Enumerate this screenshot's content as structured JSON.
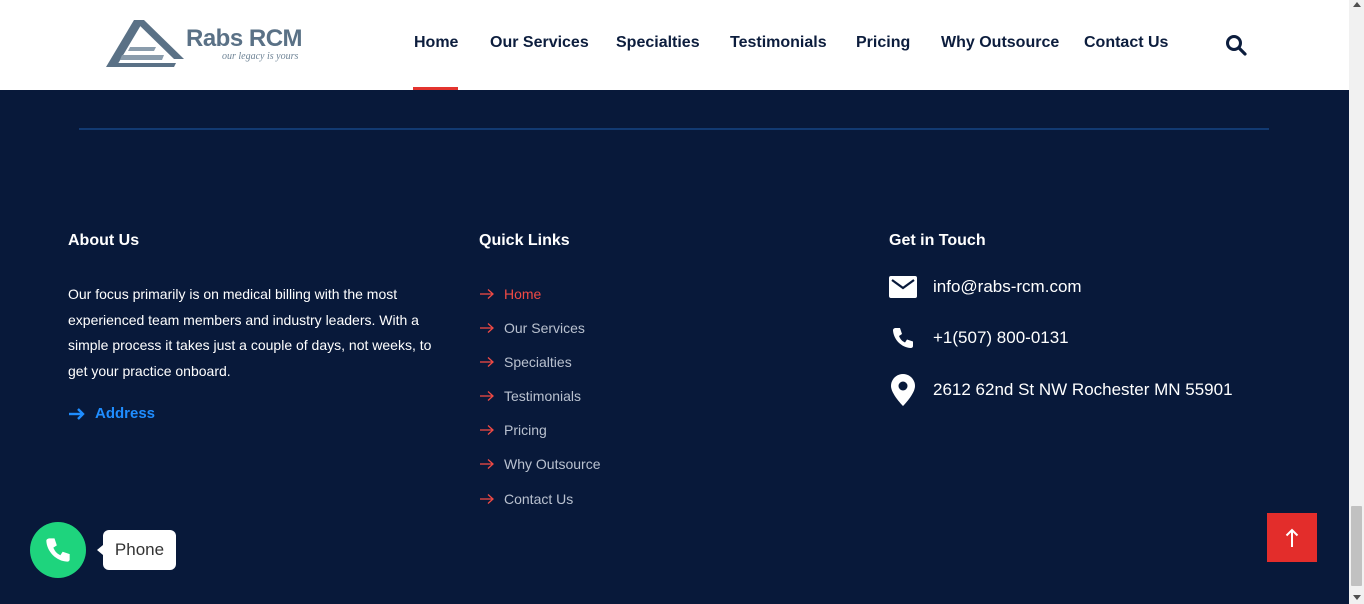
{
  "header": {
    "logo": {
      "name": "Rabs RCM",
      "tagline": "our legacy is yours"
    },
    "nav": [
      {
        "label": "Home",
        "active": true
      },
      {
        "label": "Our Services"
      },
      {
        "label": "Specialties"
      },
      {
        "label": "Testimonials"
      },
      {
        "label": "Pricing"
      },
      {
        "label": "Why Outsource"
      },
      {
        "label": "Contact Us"
      }
    ],
    "search_icon": "search-icon"
  },
  "footer": {
    "about": {
      "title": "About Us",
      "text": "Our focus primarily is on medical billing with the most experienced team members and industry leaders. With a simple process it takes just a couple of days, not weeks, to get your practice onboard.",
      "address_link": "Address"
    },
    "quick_links": {
      "title": "Quick Links",
      "items": [
        {
          "label": "Home",
          "active": true
        },
        {
          "label": "Our Services"
        },
        {
          "label": "Specialties"
        },
        {
          "label": "Testimonials"
        },
        {
          "label": "Pricing"
        },
        {
          "label": "Why Outsource"
        },
        {
          "label": "Contact Us"
        }
      ]
    },
    "contact": {
      "title": "Get in Touch",
      "email": "info@rabs-rcm.com",
      "phone": "+1(507) 800-0131",
      "address": "2612 62nd St NW Rochester MN 55901"
    }
  },
  "widgets": {
    "phone_label": "Phone"
  },
  "colors": {
    "background": "#08193a",
    "accent_red": "#e3342f",
    "link_blue": "#1f8dff",
    "phone_green": "#1ed47d"
  }
}
